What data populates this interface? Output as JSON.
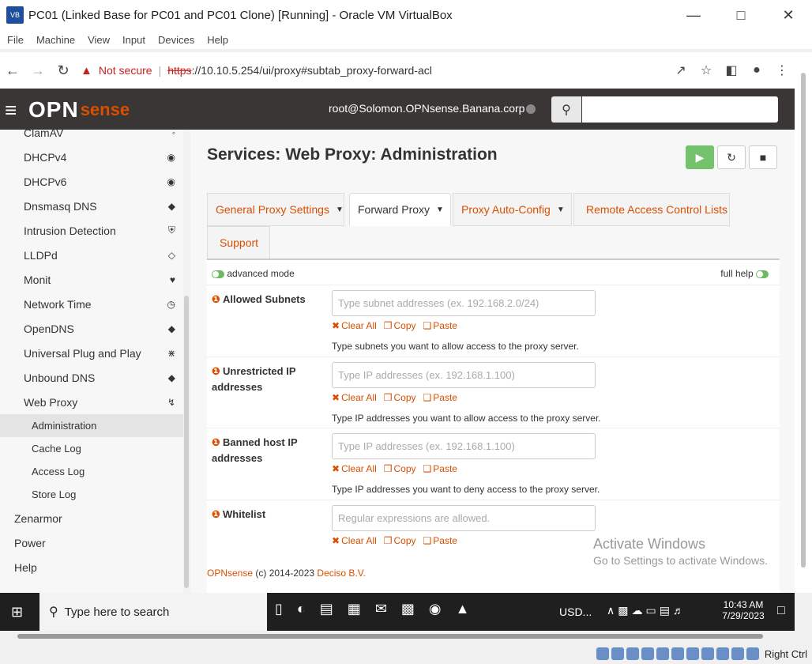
{
  "vbox": {
    "title": "PC01 (Linked Base for PC01 and PC01 Clone) [Running] - Oracle VM VirtualBox",
    "menu": [
      "File",
      "Machine",
      "View",
      "Input",
      "Devices",
      "Help"
    ],
    "hostkey": "Right Ctrl"
  },
  "browser": {
    "security": "Not secure",
    "scheme": "https",
    "url_rest": "://10.10.5.254/ui/proxy#subtab_proxy-forward-acl"
  },
  "opn": {
    "logo_main": "OPN",
    "logo_sense": "sense",
    "user": "root@Solomon.OPNsense.Banana.corp",
    "search_placeholder": ""
  },
  "sidebar": {
    "items": [
      {
        "label": "ClamAV",
        "icon": "clam-icon"
      },
      {
        "label": "DHCPv4",
        "icon": "dhcp-icon"
      },
      {
        "label": "DHCPv6",
        "icon": "dhcp-icon"
      },
      {
        "label": "Dnsmasq DNS",
        "icon": "tags-icon"
      },
      {
        "label": "Intrusion Detection",
        "icon": "shield-icon"
      },
      {
        "label": "LLDPd",
        "icon": "binoculars-icon"
      },
      {
        "label": "Monit",
        "icon": "heartbeat-icon"
      },
      {
        "label": "Network Time",
        "icon": "clock-icon"
      },
      {
        "label": "OpenDNS",
        "icon": "tags-icon"
      },
      {
        "label": "Universal Plug and Play",
        "icon": "plug-icon"
      },
      {
        "label": "Unbound DNS",
        "icon": "tags-icon"
      },
      {
        "label": "Web Proxy",
        "icon": "bolt-icon"
      }
    ],
    "sub": [
      "Administration",
      "Cache Log",
      "Access Log",
      "Store Log"
    ],
    "top": [
      "Zenarmor",
      "Power",
      "Help"
    ]
  },
  "page": {
    "title": "Services: Web Proxy: Administration",
    "tabs": [
      "General Proxy Settings",
      "Forward Proxy",
      "Proxy Auto-Config",
      "Remote Access Control Lists",
      "Support"
    ],
    "advanced_mode": "advanced mode",
    "full_help": "full help",
    "fields": [
      {
        "label": "Allowed Subnets",
        "placeholder": "Type subnet addresses (ex. 192.168.2.0/24)",
        "help": "Type subnets you want to allow access to the proxy server."
      },
      {
        "label": "Unrestricted IP addresses",
        "placeholder": "Type IP addresses (ex. 192.168.1.100)",
        "help": "Type IP addresses you want to allow access to the proxy server."
      },
      {
        "label": "Banned host IP addresses",
        "placeholder": "Type IP addresses (ex. 192.168.1.100)",
        "help": "Type IP addresses you want to deny access to the proxy server."
      },
      {
        "label": "Whitelist",
        "placeholder": "Regular expressions are allowed.",
        "help": ""
      }
    ],
    "actions": {
      "clear": "Clear All",
      "copy": "Copy",
      "paste": "Paste"
    },
    "footer_brand": "OPNsense",
    "footer_mid": " (c) 2014-2023 ",
    "footer_company": "Deciso B.V."
  },
  "watermark": {
    "line1": "Activate Windows",
    "line2": "Go to Settings to activate Windows."
  },
  "taskbar": {
    "search": "Type here to search",
    "usd": "USD...",
    "time": "10:43 AM",
    "date": "7/29/2023"
  }
}
